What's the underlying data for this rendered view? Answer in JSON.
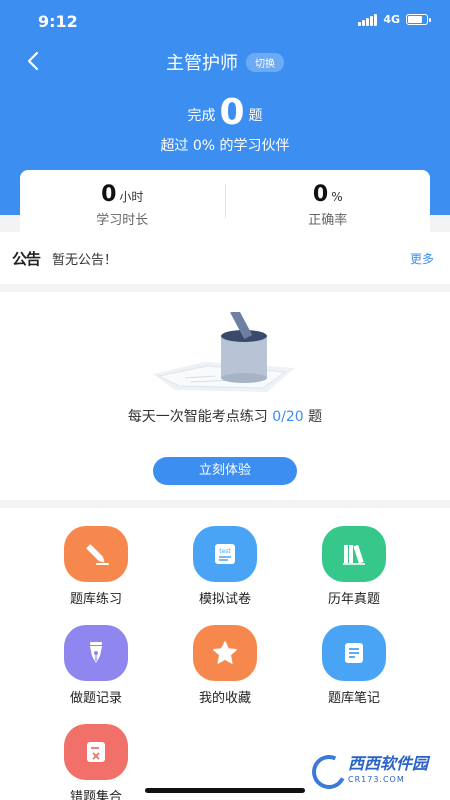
{
  "status_bar": {
    "time": "9:12",
    "network": "4G"
  },
  "nav": {
    "title": "主管护师",
    "switch_label": "切换",
    "back_glyph": "‹"
  },
  "summary": {
    "done_prefix": "完成",
    "done_count": "0",
    "done_suffix": "题",
    "beat_text": "超过 0% 的学习伙伴"
  },
  "stats": {
    "duration": {
      "value": "0",
      "unit": "小时",
      "label": "学习时长"
    },
    "accuracy": {
      "value": "0",
      "unit": "%",
      "label": "正确率"
    }
  },
  "notice": {
    "logo": "公告",
    "text": "暂无公告！",
    "more": "更多"
  },
  "practice": {
    "text_prefix": "每天一次智能考点练习 ",
    "count": "0/20",
    "text_suffix": " 题",
    "button": "立刻体验"
  },
  "grid": [
    {
      "label": "题库练习",
      "icon": "pencil-icon",
      "color": "#f7884d"
    },
    {
      "label": "模拟试卷",
      "icon": "test-paper-icon",
      "color": "#4aa4f5"
    },
    {
      "label": "历年真题",
      "icon": "books-icon",
      "color": "#36c78a"
    },
    {
      "label": "做题记录",
      "icon": "pen-nib-icon",
      "color": "#8f86f0"
    },
    {
      "label": "我的收藏",
      "icon": "star-icon",
      "color": "#f7884d"
    },
    {
      "label": "题库笔记",
      "icon": "notebook-icon",
      "color": "#4aa4f5"
    },
    {
      "label": "错题集合",
      "icon": "wrong-paper-icon",
      "color": "#f2706a"
    }
  ],
  "watermark": {
    "brand": "西西软件园",
    "domain": "CR173.COM"
  },
  "colors": {
    "primary": "#3d8ef1"
  }
}
